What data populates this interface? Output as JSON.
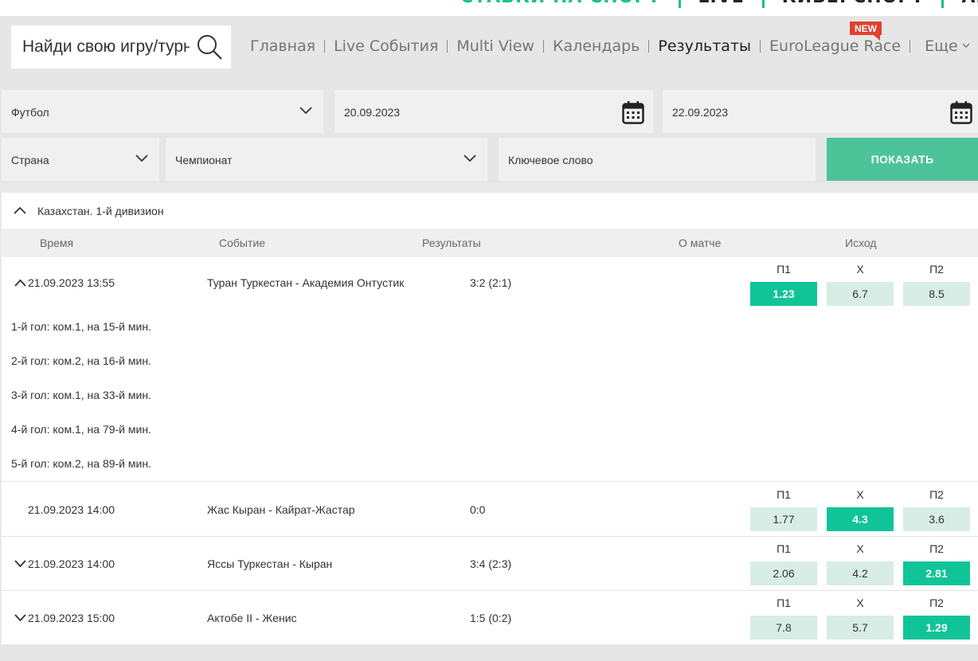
{
  "top_nav": {
    "items": [
      "СТАВКИ НА СПОРТ",
      "LIVE",
      "КИБЕРСПОРТ",
      "АКЦИИ"
    ]
  },
  "search": {
    "placeholder": "Найди свою игру/турнир"
  },
  "menu": {
    "items": [
      "Главная",
      "Live События",
      "Multi View",
      "Календарь",
      "Результаты",
      "EuroLeague Race"
    ],
    "active_index": 4,
    "new_badge": "NEW",
    "more_label": "Еще"
  },
  "filters": {
    "sport": "Футбол",
    "date_from": "20.09.2023",
    "date_to": "22.09.2023",
    "country": "Страна",
    "championship": "Чемпионат",
    "keyword_placeholder": "Ключевое слово",
    "show_button": "ПОКАЗАТЬ"
  },
  "group": {
    "title": "Казахстан. 1-й дивизион",
    "columns": {
      "time": "Время",
      "event": "Событие",
      "results": "Результаты",
      "about": "О матче",
      "outcome": "Исход"
    },
    "odds_labels": [
      "П1",
      "X",
      "П2"
    ],
    "matches": [
      {
        "time": "21.09.2023 13:55",
        "event": "Туран Туркестан - Академия Онтустик",
        "score": "3:2 (2:1)",
        "odds": [
          "1.23",
          "6.7",
          "8.5"
        ],
        "winner": 0,
        "expander": "up",
        "goals": [
          "1-й гол: ком.1, на 15-й мин.",
          "2-й гол: ком.2, на 16-й мин.",
          "3-й гол: ком.1, на 33-й мин.",
          "4-й гол: ком.1, на 79-й мин.",
          "5-й гол: ком.2, на 89-й мин."
        ]
      },
      {
        "time": "21.09.2023 14:00",
        "event": "Жас Кыран - Кайрат-Жастар",
        "score": "0:0",
        "odds": [
          "1.77",
          "4.3",
          "3.6"
        ],
        "winner": 1,
        "expander": "none",
        "goals": []
      },
      {
        "time": "21.09.2023 14:00",
        "event": "Яссы Туркестан - Кыран",
        "score": "3:4 (2:3)",
        "odds": [
          "2.06",
          "4.2",
          "2.81"
        ],
        "winner": 2,
        "expander": "down",
        "goals": []
      },
      {
        "time": "21.09.2023 15:00",
        "event": "Актобе II - Женис",
        "score": "1:5 (0:2)",
        "odds": [
          "7.8",
          "5.7",
          "1.29"
        ],
        "winner": 2,
        "expander": "down",
        "goals": []
      }
    ]
  },
  "colors": {
    "accent": "#14c08f",
    "win_odd": "#10c497",
    "odd_bg": "#d8ede6",
    "show_button": "#4dc39a",
    "new_badge": "#e0412e"
  }
}
